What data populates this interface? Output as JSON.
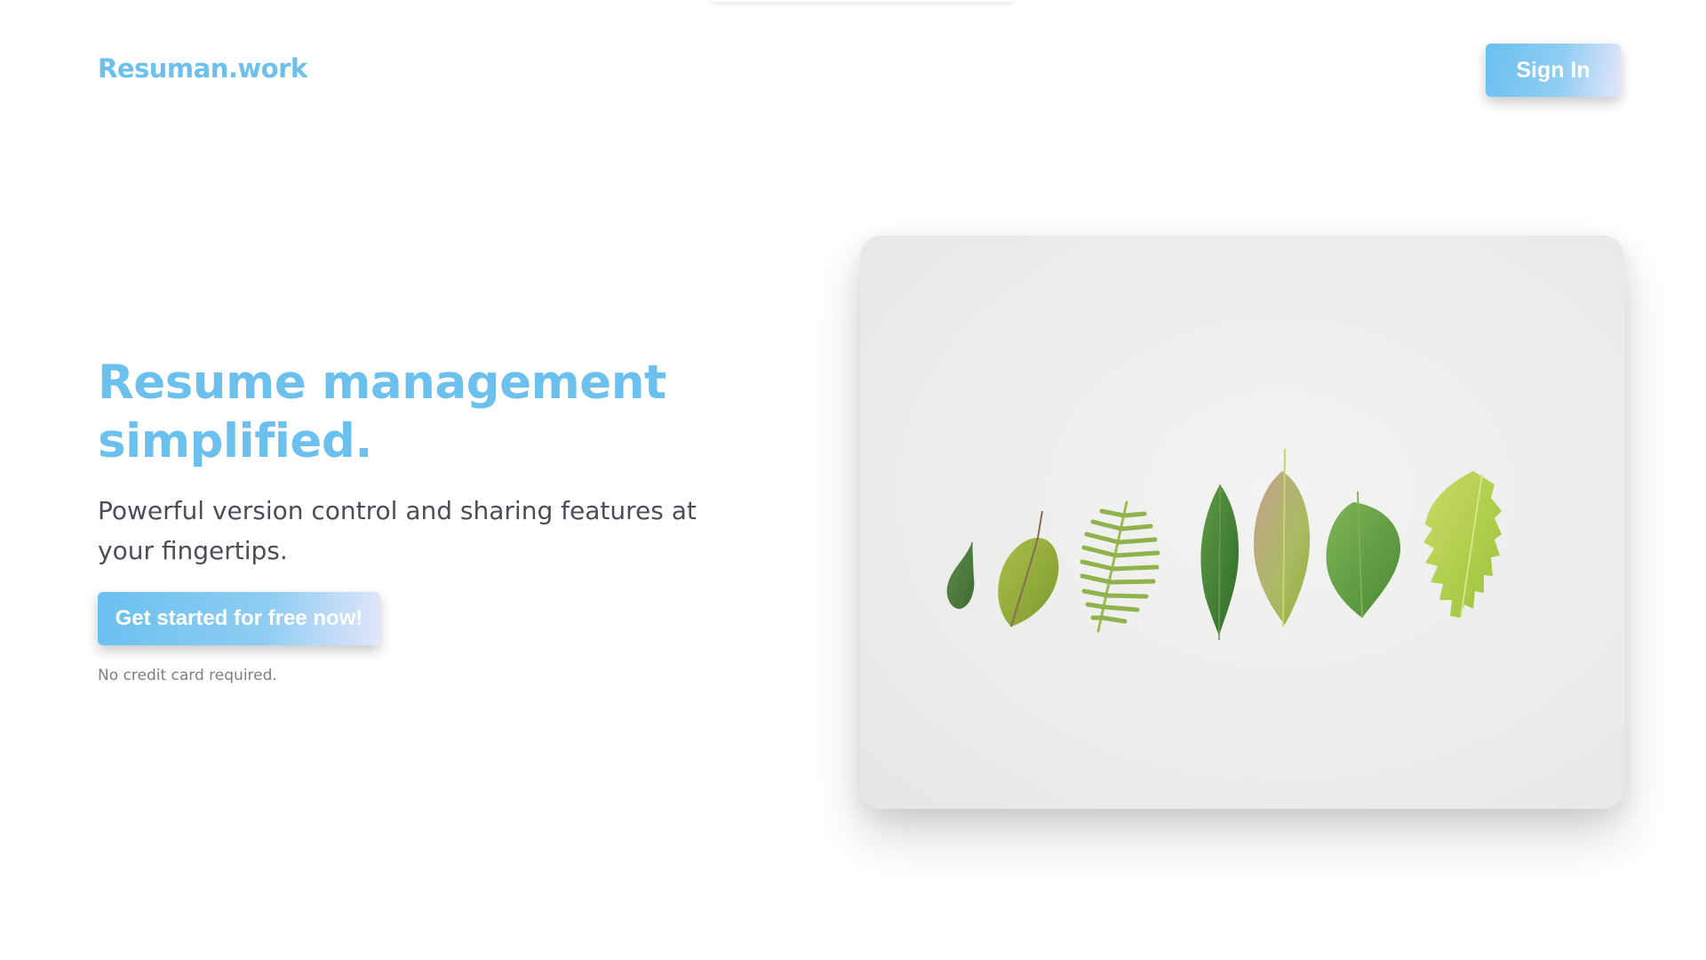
{
  "header": {
    "brand": "Resuman.work",
    "signin_label": "Sign In"
  },
  "hero": {
    "title": "Resume management simplified.",
    "subtitle": "Powerful version control and sharing features at your fingertips.",
    "cta_label": "Get started for free now!",
    "note": "No credit card required."
  },
  "image": {
    "subject": "seven leaves in a row on white background"
  },
  "colors": {
    "accent": "#6cc0ed",
    "text": "#4a4e55",
    "muted": "#7b7f86",
    "button_gradient_start": "#69c0ef",
    "button_gradient_end": "#e4e6fb"
  }
}
